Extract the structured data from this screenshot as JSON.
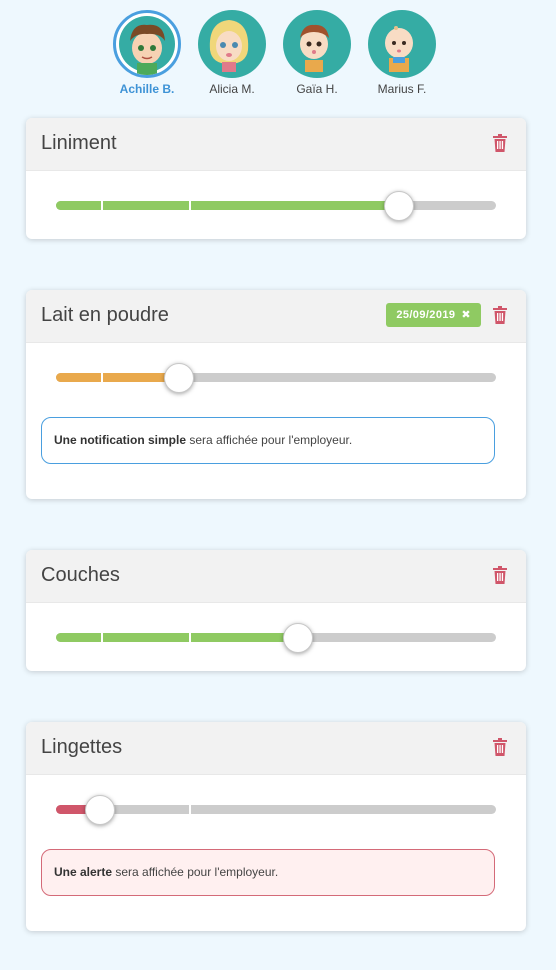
{
  "colors": {
    "green": "#8fca62",
    "orange": "#e9a94c",
    "red": "#d0566a",
    "trash": "#d0566a",
    "active_blue": "#3e93d6",
    "teal_avatar": "#35aca4"
  },
  "children": [
    {
      "name": "Achille B.",
      "active": true
    },
    {
      "name": "Alicia M.",
      "active": false
    },
    {
      "name": "Gaïa H.",
      "active": false
    },
    {
      "name": "Marius F.",
      "active": false
    }
  ],
  "items": [
    {
      "title": "Liniment",
      "level_percent": 78,
      "fill_color": "green",
      "date_badge": null,
      "notice": null
    },
    {
      "title": "Lait en poudre",
      "level_percent": 28,
      "fill_color": "orange",
      "date_badge": "25/09/2019",
      "notice": {
        "type": "info",
        "bold": "Une notification simple",
        "text": " sera affichée pour l'employeur."
      }
    },
    {
      "title": "Couches",
      "level_percent": 55,
      "fill_color": "green",
      "date_badge": null,
      "notice": null
    },
    {
      "title": "Lingettes",
      "level_percent": 10,
      "fill_color": "red",
      "date_badge": null,
      "notice": {
        "type": "alert",
        "bold": "Une alerte",
        "text": " sera affichée pour l'employeur."
      }
    }
  ]
}
